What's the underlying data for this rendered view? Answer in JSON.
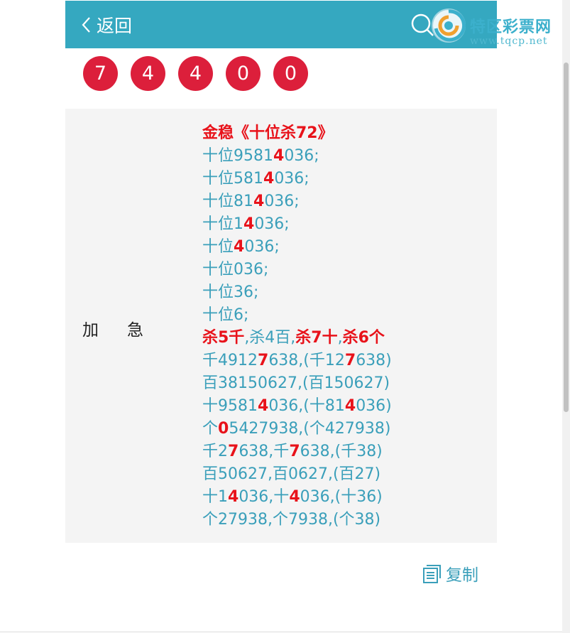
{
  "header": {
    "back_label": "返回"
  },
  "watermark": {
    "title": "特区彩票网",
    "url": "www.tqcp.net"
  },
  "balls": [
    "7",
    "4",
    "4",
    "0",
    "0"
  ],
  "content": {
    "label": "加急",
    "lines": [
      [
        {
          "t": "金稳《十位杀72》",
          "r": true
        }
      ],
      [
        {
          "t": "十位9581"
        },
        {
          "t": "4",
          "r": true
        },
        {
          "t": "036;"
        }
      ],
      [
        {
          "t": "十位581"
        },
        {
          "t": "4",
          "r": true
        },
        {
          "t": "036;"
        }
      ],
      [
        {
          "t": "十位81"
        },
        {
          "t": "4",
          "r": true
        },
        {
          "t": "036;"
        }
      ],
      [
        {
          "t": "十位1"
        },
        {
          "t": "4",
          "r": true
        },
        {
          "t": "036;"
        }
      ],
      [
        {
          "t": "十位"
        },
        {
          "t": "4",
          "r": true
        },
        {
          "t": "036;"
        }
      ],
      [
        {
          "t": "十位036;"
        }
      ],
      [
        {
          "t": "十位36;"
        }
      ],
      [
        {
          "t": "十位6;"
        }
      ],
      [
        {
          "t": "杀5千",
          "r": true
        },
        {
          "t": ",杀4百,"
        },
        {
          "t": "杀7十",
          "r": true
        },
        {
          "t": ","
        },
        {
          "t": "杀6个",
          "r": true
        }
      ],
      [
        {
          "t": "千4912"
        },
        {
          "t": "7",
          "r": true
        },
        {
          "t": "638,(千12"
        },
        {
          "t": "7",
          "r": true
        },
        {
          "t": "638)"
        }
      ],
      [
        {
          "t": "百38150627,(百150627)"
        }
      ],
      [
        {
          "t": "十9581"
        },
        {
          "t": "4",
          "r": true
        },
        {
          "t": "036,(十81"
        },
        {
          "t": "4",
          "r": true
        },
        {
          "t": "036)"
        }
      ],
      [
        {
          "t": "个"
        },
        {
          "t": "0",
          "r": true
        },
        {
          "t": "5427938,(个427938)"
        }
      ],
      [
        {
          "t": "千2"
        },
        {
          "t": "7",
          "r": true
        },
        {
          "t": "638,千"
        },
        {
          "t": "7",
          "r": true
        },
        {
          "t": "638,(千38)"
        }
      ],
      [
        {
          "t": "百50627,百0627,(百27)"
        }
      ],
      [
        {
          "t": "十1"
        },
        {
          "t": "4",
          "r": true
        },
        {
          "t": "036,十"
        },
        {
          "t": "4",
          "r": true
        },
        {
          "t": "036,(十36)"
        }
      ],
      [
        {
          "t": "个27938,个7938,(个38)"
        }
      ]
    ]
  },
  "copy": {
    "label": "复制"
  },
  "colors": {
    "header": "#35a8c0",
    "ball": "#dc1f3b",
    "text": "#3a9fba",
    "highlight": "#e8121a"
  },
  "icons": {
    "back": "chevron-left-icon",
    "search": "search-icon",
    "copy": "copy-icon"
  }
}
